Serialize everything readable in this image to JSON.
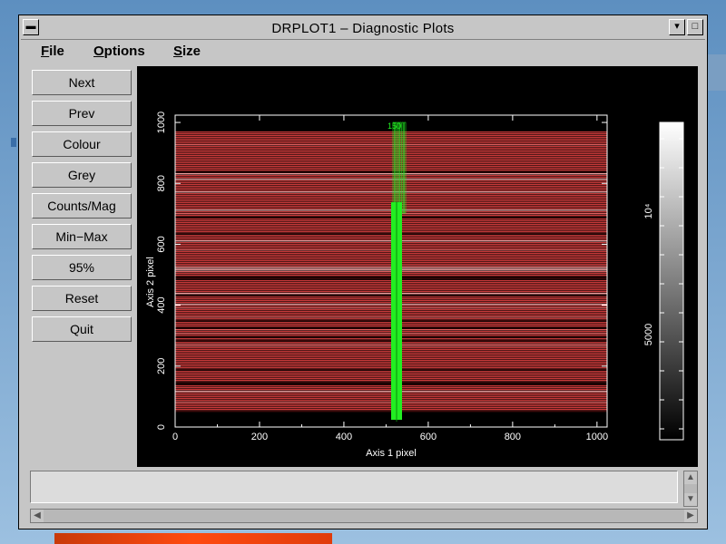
{
  "window": {
    "title": "DRPLOT1 – Diagnostic Plots",
    "menu_icon": "window-menu-icon",
    "min_icon": "minimize-icon",
    "max_icon": "maximize-icon"
  },
  "menu": {
    "file": {
      "ul": "F",
      "rest": "ile"
    },
    "options": {
      "ul": "O",
      "rest": "ptions"
    },
    "size": {
      "ul": "S",
      "rest": "ize"
    }
  },
  "buttons": [
    "Next",
    "Prev",
    "Colour",
    "Grey",
    "Counts/Mag",
    "Min−Max",
    "95%",
    "Reset",
    "Quit"
  ],
  "status": {
    "text": ""
  },
  "plot": {
    "x_axis_label": "Axis 1 pixel",
    "y_axis_label": "Axis 2 pixel",
    "x_ticks": [
      "0",
      "200",
      "400",
      "600",
      "800",
      "1000"
    ],
    "y_ticks": [
      "0",
      "200",
      "400",
      "600",
      "800",
      "1000"
    ],
    "colorbar_labels": [
      "5000",
      "10⁴"
    ],
    "trace_label": "150",
    "colors": {
      "image": "#c83a3a",
      "trace": "#22ee22",
      "axes": "#ffffff",
      "background": "#000000"
    }
  }
}
